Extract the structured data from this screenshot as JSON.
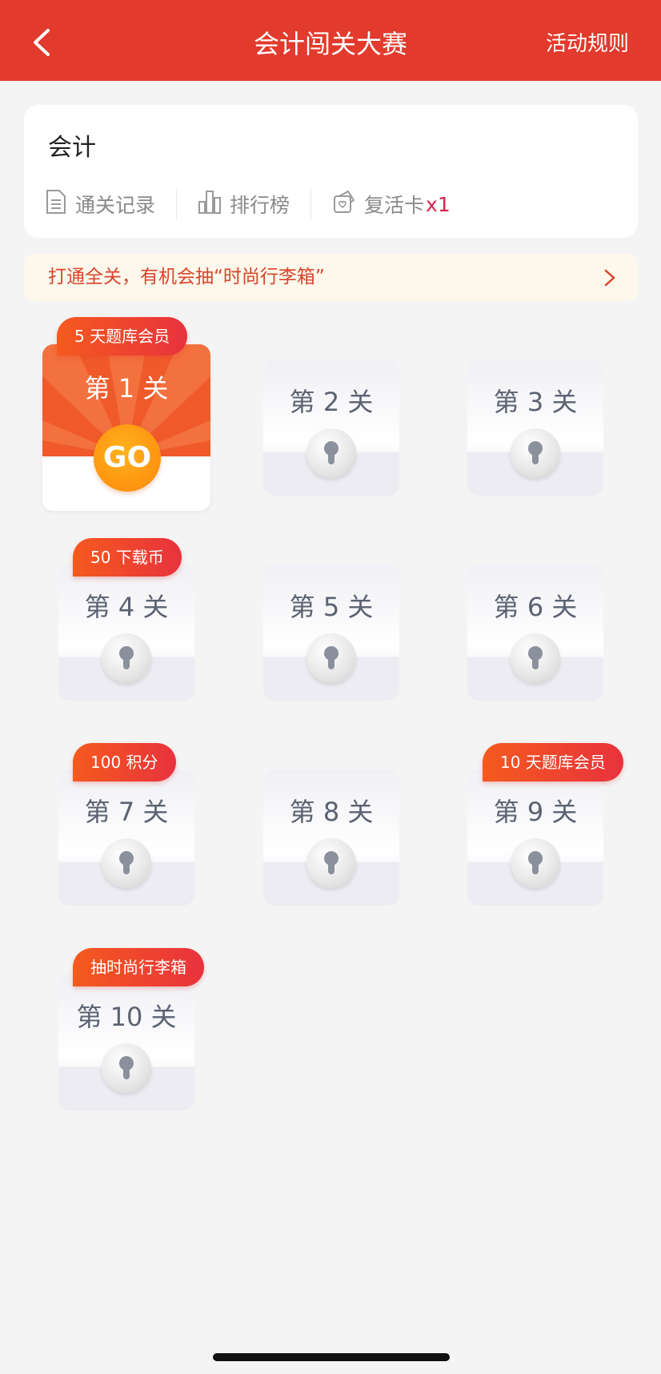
{
  "nav": {
    "title": "会计闯关大赛",
    "rules": "活动规则"
  },
  "card": {
    "subject": "会计",
    "records": "通关记录",
    "ranking": "排行榜",
    "revive": "复活卡",
    "revive_count": "x1"
  },
  "banner": {
    "text": "打通全关，有机会抽“时尚行李箱”"
  },
  "levels": [
    {
      "label": "第 1 关",
      "badge": "5 天题库会员",
      "go": "GO"
    },
    {
      "label": "第 2 关"
    },
    {
      "label": "第 3 关"
    },
    {
      "label": "第 4 关",
      "badge": "50 下载币"
    },
    {
      "label": "第 5 关"
    },
    {
      "label": "第 6 关"
    },
    {
      "label": "第 7 关",
      "badge": "100 积分"
    },
    {
      "label": "第 8 关"
    },
    {
      "label": "第 9 关",
      "badge": "10 天题库会员"
    },
    {
      "label": "第 10 关",
      "badge": "抽时尚行李箱"
    }
  ],
  "colors": {
    "brand": "#e23a2c",
    "badge": "#ef4a2c",
    "go": "#ff9a12",
    "revive_count": "#d2264a"
  }
}
